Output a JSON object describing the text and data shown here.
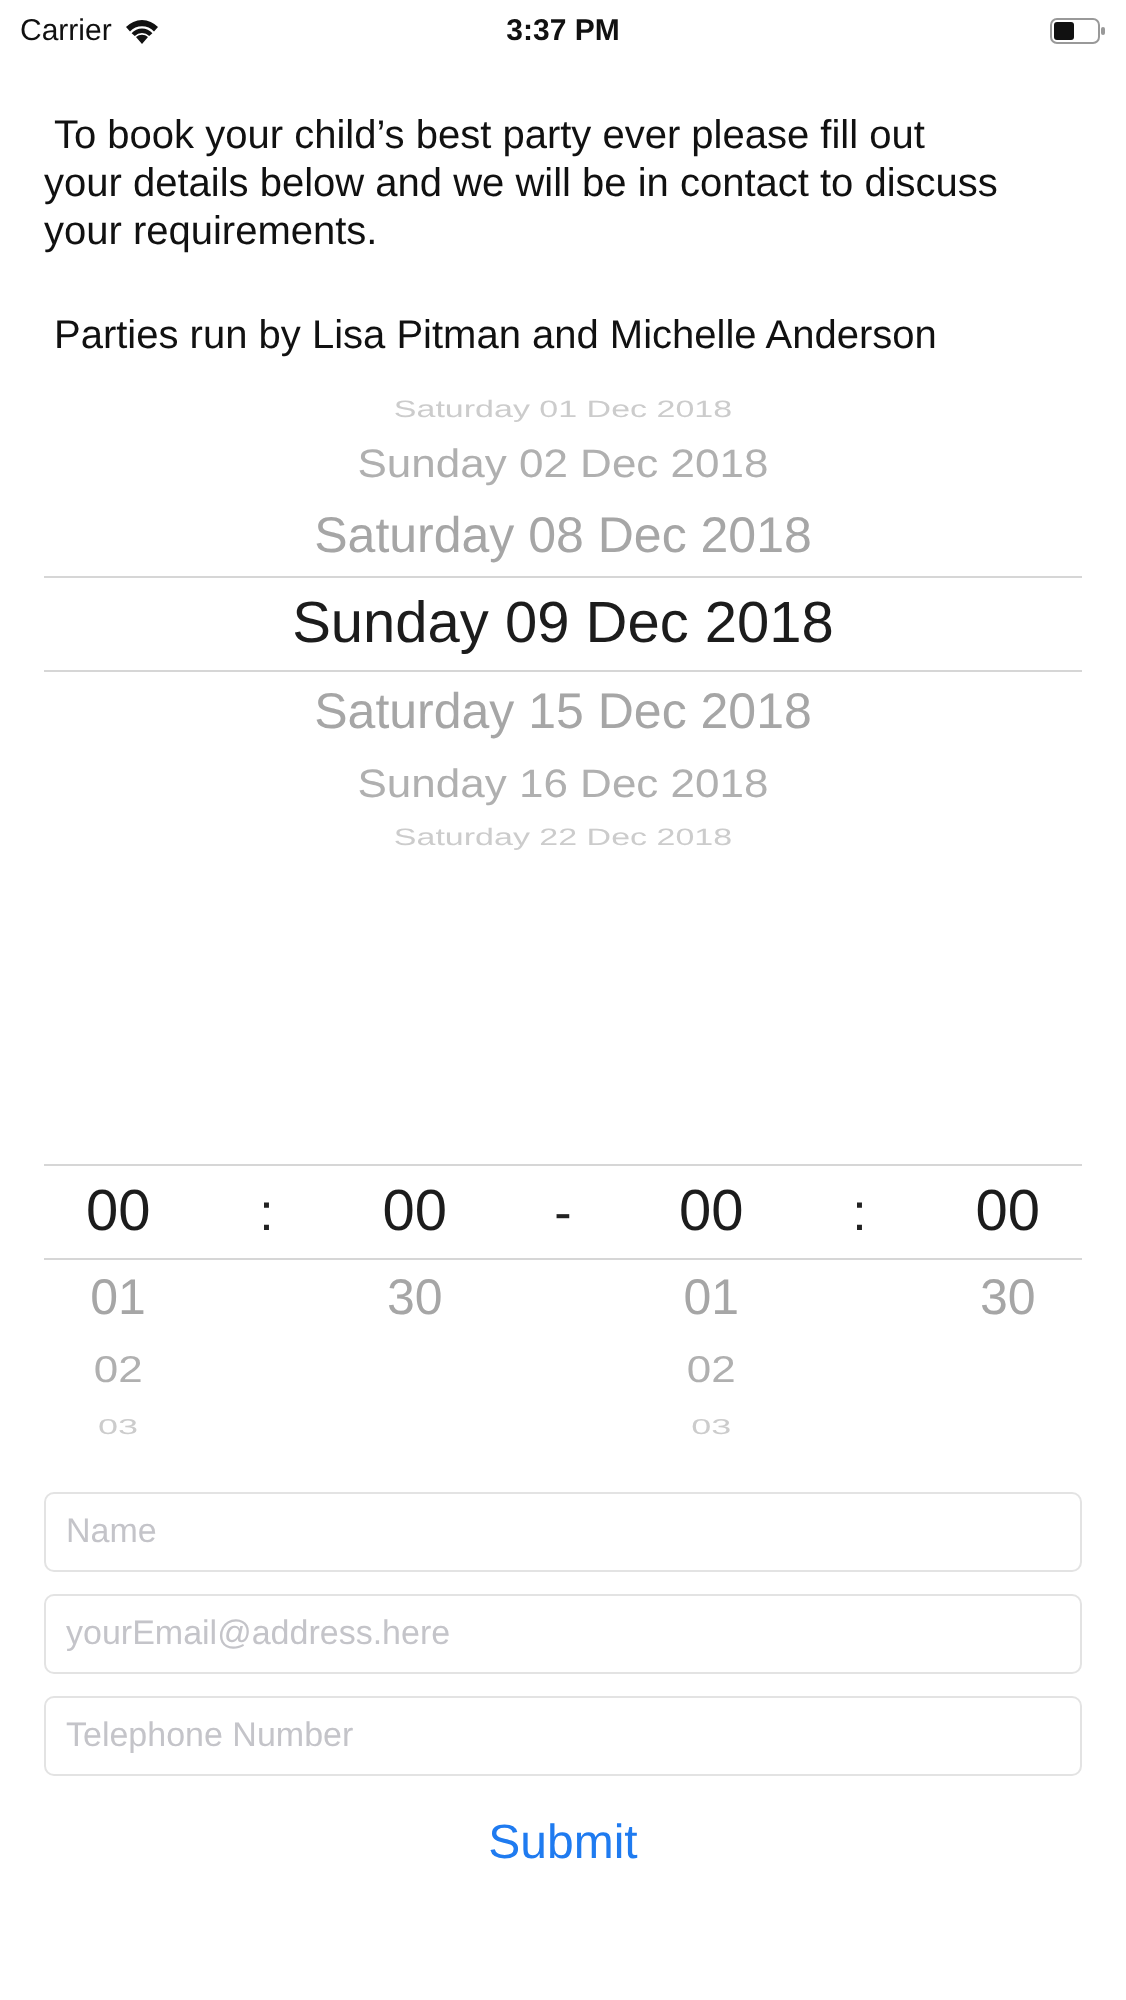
{
  "status_bar": {
    "carrier": "Carrier",
    "time": "3:37 PM"
  },
  "intro": "To book your child’s best party ever please fill out your details below and we will be in contact to discuss your requirements.",
  "organisers": "Parties run by Lisa Pitman and Michelle Anderson",
  "date_picker": {
    "options": [
      {
        "label": "Saturday 01 Dec 2018",
        "selected": false
      },
      {
        "label": "Sunday 02 Dec 2018",
        "selected": false
      },
      {
        "label": "Saturday 08 Dec 2018",
        "selected": false
      },
      {
        "label": "Sunday 09 Dec 2018",
        "selected": true
      },
      {
        "label": "Saturday 15 Dec 2018",
        "selected": false
      },
      {
        "label": "Sunday 16 Dec 2018",
        "selected": false
      },
      {
        "label": "Saturday 22 Dec 2018",
        "selected": false
      }
    ]
  },
  "time_picker": {
    "columns": [
      {
        "kind": "wheel",
        "options": [
          {
            "label": "00",
            "selected": true
          },
          {
            "label": "01",
            "selected": false
          },
          {
            "label": "02",
            "selected": false
          },
          {
            "label": "03",
            "selected": false
          }
        ]
      },
      {
        "kind": "separator",
        "label": ":"
      },
      {
        "kind": "wheel",
        "options": [
          {
            "label": "00",
            "selected": true
          },
          {
            "label": "30",
            "selected": false
          }
        ]
      },
      {
        "kind": "separator",
        "label": "-"
      },
      {
        "kind": "wheel",
        "options": [
          {
            "label": "00",
            "selected": true
          },
          {
            "label": "01",
            "selected": false
          },
          {
            "label": "02",
            "selected": false
          },
          {
            "label": "03",
            "selected": false
          }
        ]
      },
      {
        "kind": "separator",
        "label": ":"
      },
      {
        "kind": "wheel",
        "options": [
          {
            "label": "00",
            "selected": true
          },
          {
            "label": "30",
            "selected": false
          }
        ]
      }
    ]
  },
  "fields": [
    {
      "placeholder": "Name"
    },
    {
      "placeholder": "yourEmail@address.here"
    },
    {
      "placeholder": "Telephone Number"
    }
  ],
  "submit": "Submit"
}
